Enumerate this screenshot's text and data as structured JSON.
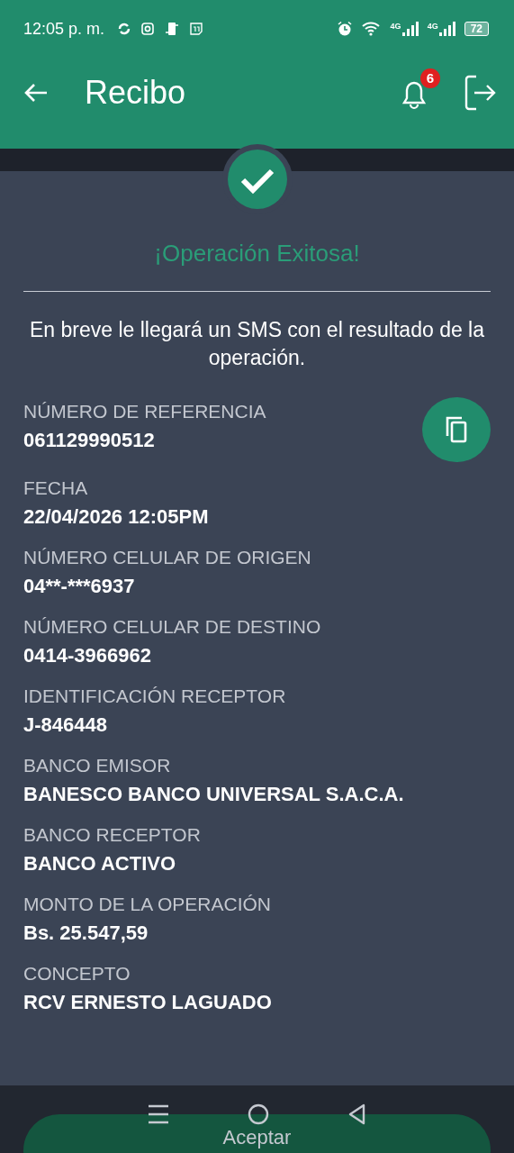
{
  "status_bar": {
    "time": "12:05 p. m.",
    "networks": [
      "4G",
      "4G"
    ],
    "battery": "72"
  },
  "header": {
    "title": "Recibo",
    "notifications": "6"
  },
  "result": {
    "title": "¡Operación Exitosa!",
    "message": "En breve le llegará un SMS con el resultado de la operación."
  },
  "fields": [
    {
      "label": "NÚMERO DE REFERENCIA",
      "value": "061129990512",
      "copyable": true
    },
    {
      "label": "FECHA",
      "value": "22/04/2026 12:05PM",
      "copyable": false
    },
    {
      "label": "NÚMERO CELULAR DE ORIGEN",
      "value": "04**-***6937",
      "copyable": false
    },
    {
      "label": "NÚMERO CELULAR DE DESTINO",
      "value": "0414-3966962",
      "copyable": false
    },
    {
      "label": "IDENTIFICACIÓN RECEPTOR",
      "value": "J-846448",
      "copyable": false
    },
    {
      "label": "BANCO EMISOR",
      "value": "BANESCO BANCO UNIVERSAL S.A.C.A.",
      "copyable": false
    },
    {
      "label": "BANCO RECEPTOR",
      "value": "BANCO ACTIVO",
      "copyable": false
    },
    {
      "label": "MONTO DE LA OPERACIÓN",
      "value": "Bs. 25.547,59",
      "copyable": false
    },
    {
      "label": "CONCEPTO",
      "value": "RCV ERNESTO LAGUADO",
      "copyable": false
    }
  ],
  "accept_button": "Aceptar"
}
